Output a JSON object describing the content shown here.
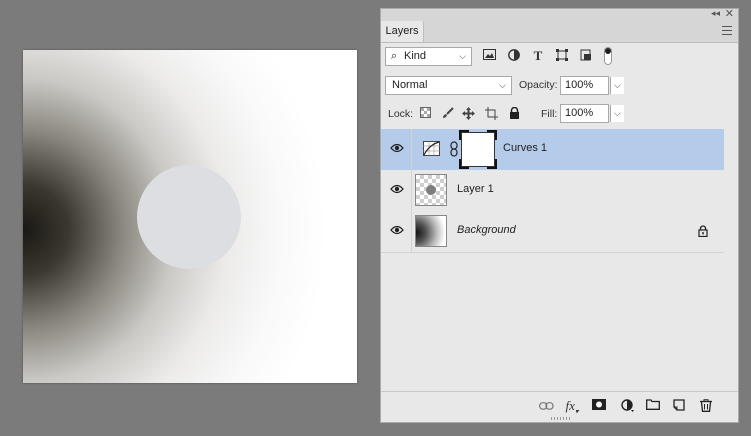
{
  "panel": {
    "tab_label": "Layers",
    "kind_filter": "Kind",
    "blend_mode": "Normal",
    "opacity_label": "Opacity:",
    "opacity_value": "100%",
    "lock_label": "Lock:",
    "fill_label": "Fill:",
    "fill_value": "100%"
  },
  "filter_icons": [
    "image-filter-icon",
    "adjustment-filter-icon",
    "type-filter-icon",
    "shape-filter-icon",
    "smart-object-filter-icon",
    "filter-toggle-icon"
  ],
  "lock_icons": [
    "lock-transparent-icon",
    "lock-image-icon",
    "lock-position-icon",
    "lock-artboard-icon",
    "lock-all-icon"
  ],
  "layers": [
    {
      "name": "Curves 1",
      "selected": true,
      "type": "adjustment"
    },
    {
      "name": "Layer 1",
      "selected": false,
      "type": "pixel"
    },
    {
      "name": "Background",
      "selected": false,
      "type": "background",
      "locked": true
    }
  ],
  "footer_icons": [
    "link-layers-icon",
    "fx-icon",
    "add-mask-icon",
    "new-adjustment-icon",
    "new-group-icon",
    "new-layer-icon",
    "delete-layer-icon"
  ],
  "colors": {
    "selection": "#b4cbea",
    "panel_bg": "#e8e8e8",
    "workspace": "#7b7b7b"
  }
}
